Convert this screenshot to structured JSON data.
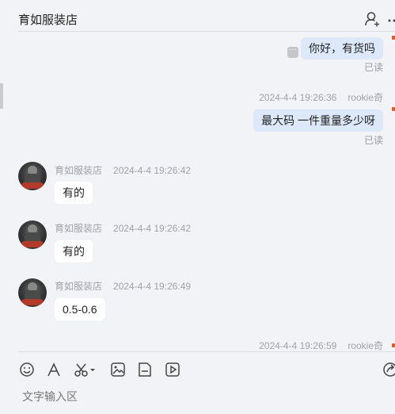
{
  "header": {
    "title": "育如服装店"
  },
  "messages": {
    "m1": {
      "text": "你好，有货吗",
      "read": "已读"
    },
    "m2": {
      "time": "2024-4-4 19:26:36",
      "sender": "rookie奇",
      "text": "最大码  一件重量多少呀",
      "read": "已读"
    },
    "m3": {
      "sender": "育如服装店",
      "time": "2024-4-4 19:26:42",
      "text": "有的"
    },
    "m4": {
      "sender": "育如服装店",
      "time": "2024-4-4 19:26:42",
      "text": "有的"
    },
    "m5": {
      "sender": "育如服装店",
      "time": "2024-4-4 19:26:49",
      "text": "0.5-0.6"
    },
    "m6": {
      "time": "2024-4-4 19:26:59",
      "sender": "rookie奇"
    }
  },
  "toolbar": {
    "icons": [
      "emoji-icon",
      "font-icon",
      "scissors-icon",
      "image-icon",
      "file-icon",
      "video-icon",
      "share-icon"
    ]
  },
  "input": {
    "placeholder": "文字输入区"
  },
  "colors": {
    "background": "#f2f3f7",
    "my_bubble": "#dde9fb",
    "their_bubble": "#ffffff",
    "meta_text": "#a0a2a8"
  }
}
